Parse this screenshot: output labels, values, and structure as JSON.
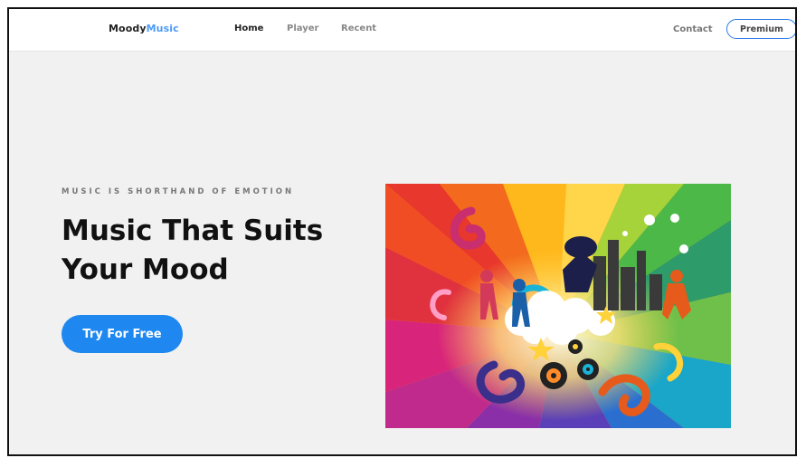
{
  "header": {
    "logo": {
      "part1": "Moody",
      "part2": "Music"
    },
    "nav": {
      "home": "Home",
      "player": "Player",
      "recent": "Recent"
    },
    "contact": "Contact",
    "premium": "Premium"
  },
  "hero": {
    "eyebrow": "MUSIC IS SHORTHAND OF EMOTION",
    "title_line1": "Music That Suits",
    "title_line2": "Your Mood",
    "cta": "Try For Free"
  },
  "colors": {
    "accent": "#1e88f0",
    "logo_accent": "#4f9bf7",
    "page_bg": "#f1f1f1"
  }
}
